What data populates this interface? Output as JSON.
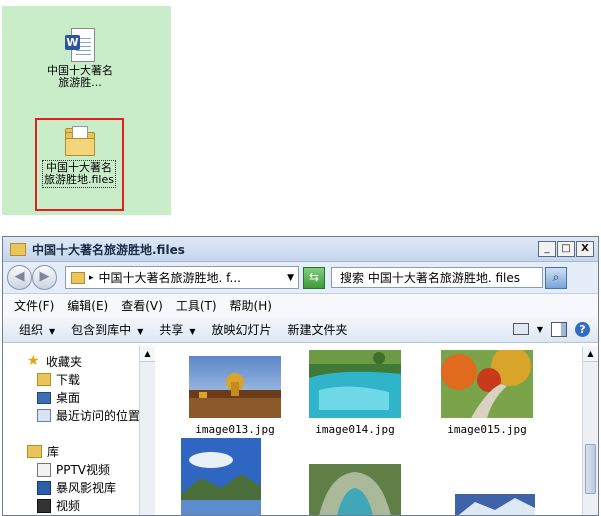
{
  "desktop": {
    "doc_icon": {
      "icon": "word-document-icon",
      "label": "中国十大著名旅游胜..."
    },
    "folder_icon": {
      "icon": "folder-icon",
      "label": "中国十大著名旅游胜地.files"
    }
  },
  "window": {
    "title": "中国十大著名旅游胜地.files",
    "buttons": {
      "minimize": "_",
      "maximize": "□",
      "close": "X"
    },
    "address": {
      "path": "中国十大著名旅游胜地. f..."
    },
    "search": {
      "placeholder": "搜索 中国十大著名旅游胜地. files"
    },
    "menu": [
      "文件(F)",
      "编辑(E)",
      "查看(V)",
      "工具(T)",
      "帮助(H)"
    ],
    "commands": [
      "组织",
      "包含到库中",
      "共享",
      "放映幻灯片",
      "新建文件夹"
    ],
    "nav": {
      "favorites": {
        "label": "收藏夹",
        "items": [
          "下载",
          "桌面",
          "最近访问的位置"
        ]
      },
      "libraries": {
        "label": "库",
        "items": [
          "PPTV视频",
          "暴风影视库",
          "视频"
        ]
      }
    },
    "files": [
      {
        "name": "image013.jpg"
      },
      {
        "name": "image014.jpg"
      },
      {
        "name": "image015.jpg"
      },
      {
        "name": ""
      },
      {
        "name": ""
      }
    ]
  },
  "colors": {
    "desktop_bg": "#c9ecc9",
    "selection_border": "#e02020",
    "title_bar": "#c4d5ec"
  }
}
